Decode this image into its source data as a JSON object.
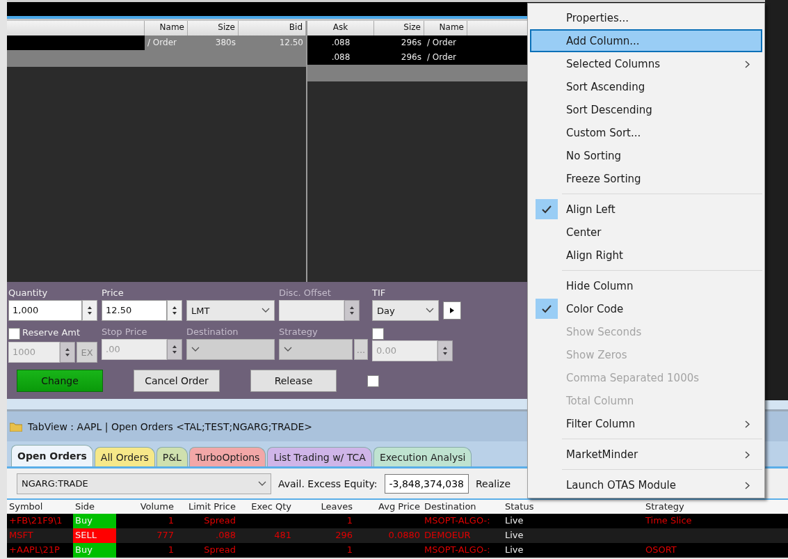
{
  "quote": {
    "bid_columns": [
      "Name",
      "Size",
      "Bid"
    ],
    "bid_rows": [
      [
        "/ Order",
        "380s",
        "12.50"
      ]
    ],
    "ask_columns": [
      "Ask",
      "Size",
      "Name"
    ],
    "ask_rows": [
      [
        ".088",
        "296s",
        "/ Order"
      ],
      [
        ".088",
        "296s",
        "/ Order"
      ]
    ]
  },
  "order_entry": {
    "quantity": {
      "label": "Quantity",
      "value": "1,000",
      "disabled": false
    },
    "price": {
      "label": "Price",
      "value": "12.50",
      "disabled": false
    },
    "order_type": {
      "value": "LMT",
      "disabled": false
    },
    "disc_offset": {
      "label": "Disc. Offset",
      "disabled": true
    },
    "tif": {
      "label": "TIF",
      "value": "Day",
      "disabled": false
    },
    "reserve_amt": {
      "label": "Reserve Amt",
      "checked": false,
      "value": "1000",
      "disabled": true,
      "button": "EX"
    },
    "stop_price": {
      "label": "Stop Price",
      "value": ".00",
      "disabled": true
    },
    "destination": {
      "label": "Destination",
      "disabled": true
    },
    "strategy": {
      "label": "Strategy",
      "disabled": true,
      "button": "..."
    },
    "extra_value": {
      "checked": false,
      "value": "0.00",
      "disabled": true
    },
    "buttons": [
      {
        "label": "Change",
        "kind": "primary"
      },
      {
        "label": "Cancel Order",
        "kind": "normal"
      },
      {
        "label": "Release",
        "kind": "normal"
      }
    ],
    "extra_checkbox": {
      "checked": false
    }
  },
  "tab_view": {
    "title": "TabView : AAPL | Open Orders <TAL;TEST;NGARG;TRADE>"
  },
  "tabs": [
    {
      "label": "Open Orders",
      "selected": true,
      "color": "#eef4fb"
    },
    {
      "label": "All Orders",
      "selected": false,
      "color": "#f6e889"
    },
    {
      "label": "P&L",
      "selected": false,
      "color": "#cfe0ae"
    },
    {
      "label": "TurboOptions",
      "selected": false,
      "color": "#f2a7a7"
    },
    {
      "label": "List Trading w/ TCA",
      "selected": false,
      "color": "#cfb5e8"
    },
    {
      "label": "Execution Analysi",
      "selected": false,
      "color": "#bfe3d0"
    }
  ],
  "account": {
    "value": "NGARG:TRADE",
    "equity_label": "Avail. Excess Equity:",
    "equity_value": "-3,848,374,038",
    "realized_label": "Realize"
  },
  "orders": {
    "columns": [
      "Symbol",
      "Side",
      "Volume",
      "Limit Price",
      "Exec Qty",
      "Leaves",
      "Avg Price",
      "Destination",
      "Status",
      "Strategy"
    ],
    "rows": [
      {
        "symbol": "+FB\\21F9\\1",
        "side": "Buy",
        "color": "#00c000",
        "volume": "1",
        "limit_price": "Spread",
        "leaves": "1",
        "destination": "MSOPT-ALGO-:",
        "status": "Live",
        "strategy": "Time Slice"
      },
      {
        "symbol": "MSFT",
        "side": "SELL",
        "color": "#ff0000",
        "volume": "777",
        "limit_price": ".088",
        "exec_qty": "481",
        "leaves": "296",
        "avg_price": "0.0880",
        "destination": "DEMOEUR",
        "status": "Live"
      },
      {
        "symbol": "+AAPL\\21P",
        "side": "Buy",
        "color": "#00c000",
        "volume": "1",
        "limit_price": "Spread",
        "leaves": "1",
        "destination": "MSOPT-ALGO-:",
        "status": "Live",
        "strategy": "OSORT"
      }
    ]
  },
  "menu": {
    "items": [
      {
        "kind": "item",
        "label": "Properties...",
        "selected": false,
        "checked": false,
        "disabled": false,
        "submenu": false
      },
      {
        "kind": "item",
        "label": "Add Column...",
        "selected": true,
        "checked": false,
        "disabled": false,
        "submenu": false
      },
      {
        "kind": "item",
        "label": "Selected Columns",
        "selected": false,
        "checked": false,
        "disabled": false,
        "submenu": true
      },
      {
        "kind": "item",
        "label": "Sort Ascending",
        "selected": false,
        "checked": false,
        "disabled": false,
        "submenu": false
      },
      {
        "kind": "item",
        "label": "Sort Descending",
        "selected": false,
        "checked": false,
        "disabled": false,
        "submenu": false
      },
      {
        "kind": "item",
        "label": "Custom Sort...",
        "selected": false,
        "checked": false,
        "disabled": false,
        "submenu": false
      },
      {
        "kind": "item",
        "label": "No Sorting",
        "selected": false,
        "checked": false,
        "disabled": false,
        "submenu": false
      },
      {
        "kind": "item",
        "label": "Freeze Sorting",
        "selected": false,
        "checked": false,
        "disabled": false,
        "submenu": false
      },
      {
        "kind": "separator"
      },
      {
        "kind": "item",
        "label": "Align Left",
        "selected": false,
        "checked": true,
        "disabled": false,
        "submenu": false
      },
      {
        "kind": "item",
        "label": "Center",
        "selected": false,
        "checked": false,
        "disabled": false,
        "submenu": false
      },
      {
        "kind": "item",
        "label": "Align Right",
        "selected": false,
        "checked": false,
        "disabled": false,
        "submenu": false
      },
      {
        "kind": "separator"
      },
      {
        "kind": "item",
        "label": "Hide Column",
        "selected": false,
        "checked": false,
        "disabled": false,
        "submenu": false
      },
      {
        "kind": "item",
        "label": "Color Code",
        "selected": false,
        "checked": true,
        "disabled": false,
        "submenu": false
      },
      {
        "kind": "item",
        "label": "Show Seconds",
        "selected": false,
        "checked": false,
        "disabled": true,
        "submenu": false
      },
      {
        "kind": "item",
        "label": "Show Zeros",
        "selected": false,
        "checked": false,
        "disabled": true,
        "submenu": false
      },
      {
        "kind": "item",
        "label": "Comma Separated 1000s",
        "selected": false,
        "checked": false,
        "disabled": true,
        "submenu": false
      },
      {
        "kind": "item",
        "label": "Total Column",
        "selected": false,
        "checked": false,
        "disabled": true,
        "submenu": false
      },
      {
        "kind": "item",
        "label": "Filter Column",
        "selected": false,
        "checked": false,
        "disabled": false,
        "submenu": true
      },
      {
        "kind": "separator"
      },
      {
        "kind": "item",
        "label": "MarketMinder",
        "selected": false,
        "checked": false,
        "disabled": false,
        "submenu": true
      },
      {
        "kind": "separator"
      },
      {
        "kind": "item",
        "label": "Launch OTAS Module",
        "selected": false,
        "checked": false,
        "disabled": false,
        "submenu": true
      }
    ]
  }
}
